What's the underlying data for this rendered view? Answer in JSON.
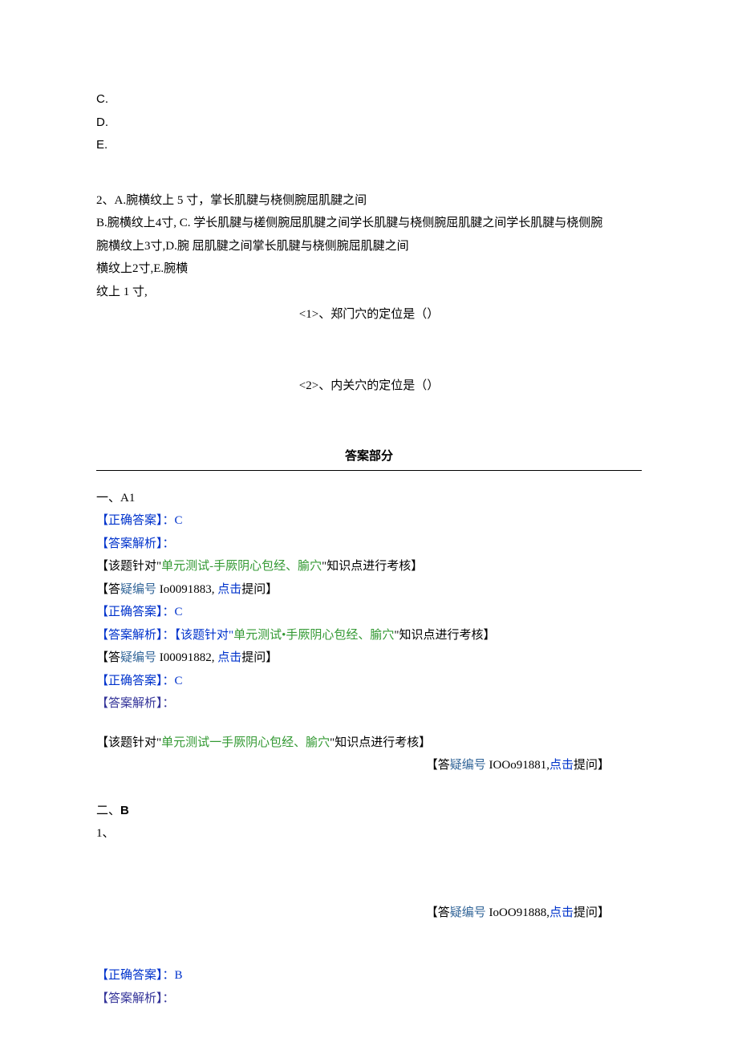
{
  "options": {
    "c": "C.",
    "d": "D.",
    "e": "E."
  },
  "q2": {
    "line1_a": "2、A.腕横纹上 5 寸，掌长肌腱与桡侧腕屈肌腱之间",
    "line2": "B.腕横纹上4寸, C. 学长肌腱与槎侧腕屈肌腱之间学长肌腱与桡侧腕屈肌腱之间学长肌腱与桡侧腕",
    "line3": "腕横纹上3寸,D.腕 屈肌腱之间掌长肌腱与桡侧腕屈肌腱之间",
    "line4": "横纹上2寸,E.腕横",
    "line5": "纹上 1 寸,",
    "sub1": "<1>、郑门穴的定位是（）",
    "sub2": "<2>、内关穴的定位是（）"
  },
  "answer_header": "答案部分",
  "section1": {
    "title": "一、A1",
    "correct1": "【正确答案】：C",
    "analysis_label1": "【答案解析】：",
    "test_prefix1": "【该题针对\"",
    "test_green1": "单元测试-手厥阴心包经、腧穴",
    "test_suffix1": "\"知识点进行考核】",
    "dayi1_prefix": "【答",
    "dayi1_teal": "疑编号",
    "dayi1_mid": " Io0091883, ",
    "dayi1_blue": "点击",
    "dayi1_suffix": "提问】",
    "correct2": "【正确答案】：C",
    "analysis2": "【答案解析】：【该题针对\"",
    "analysis2_green": "单元测试•手厥阴心包经、腧穴",
    "analysis2_suffix": "\"知识点进行考核】",
    "dayi2_prefix": "【答",
    "dayi2_teal": "疑编号",
    "dayi2_mid": " I00091882, ",
    "dayi2_blue": "点击",
    "dayi2_suffix": "提问】",
    "correct3": "【正确答案】：C",
    "analysis_label3": "【答案解析】：",
    "test_prefix3": "【该题针对\"",
    "test_green3": "单元测试一手厥阴心包经、腧穴",
    "test_suffix3": "\"知识点进行考核】",
    "dayi3_prefix": "【答",
    "dayi3_teal": "疑编号",
    "dayi3_mid": " IOOo91881,",
    "dayi3_blue": "点击",
    "dayi3_suffix": "提问】"
  },
  "section2": {
    "title_prefix": "二、",
    "title_letter": "B",
    "num1": "1、",
    "dayi_prefix": "【答",
    "dayi_teal": "疑编号",
    "dayi_mid": " IoOO91888,",
    "dayi_blue": "点击",
    "dayi_suffix": "提问】",
    "correct": "【正确答案】：B",
    "analysis_label": "【答案解析】："
  }
}
